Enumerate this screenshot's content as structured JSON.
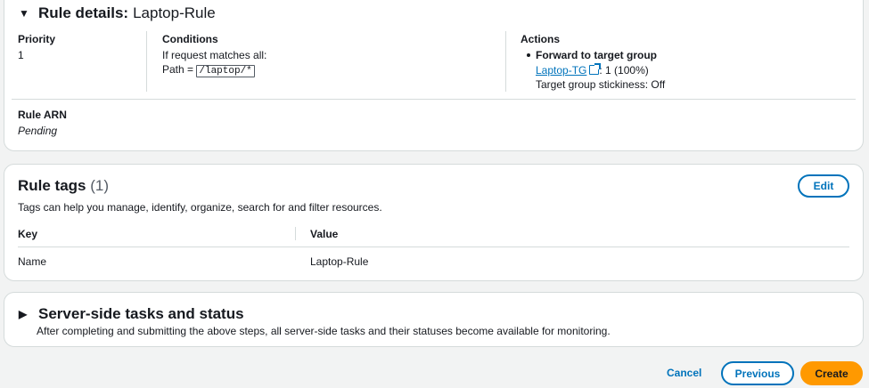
{
  "rule_details": {
    "title_prefix": "Rule details:",
    "title_name": "Laptop-Rule",
    "priority_label": "Priority",
    "priority_value": "1",
    "conditions_label": "Conditions",
    "conditions_line1": "If request matches all:",
    "conditions_path_label": "Path =",
    "conditions_path_value": "/laptop/*",
    "actions_label": "Actions",
    "actions_forward": "Forward to target group",
    "actions_tg_link": "Laptop-TG",
    "actions_tg_weight": ": 1 (100%)",
    "actions_stickiness": "Target group stickiness: Off",
    "arn_label": "Rule ARN",
    "arn_value": "Pending"
  },
  "rule_tags": {
    "title": "Rule tags",
    "count": "(1)",
    "description": "Tags can help you manage, identify, organize, search for and filter resources.",
    "edit_label": "Edit",
    "columns": [
      "Key",
      "Value"
    ],
    "rows": [
      {
        "key": "Name",
        "value": "Laptop-Rule"
      }
    ]
  },
  "server_side": {
    "title": "Server-side tasks and status",
    "description": "After completing and submitting the above steps, all server-side tasks and their statuses become available for monitoring."
  },
  "footer": {
    "cancel_label": "Cancel",
    "previous_label": "Previous",
    "create_label": "Create"
  },
  "colors": {
    "link": "#0073bb",
    "primary": "#ff9900",
    "background": "#f2f3f3"
  }
}
